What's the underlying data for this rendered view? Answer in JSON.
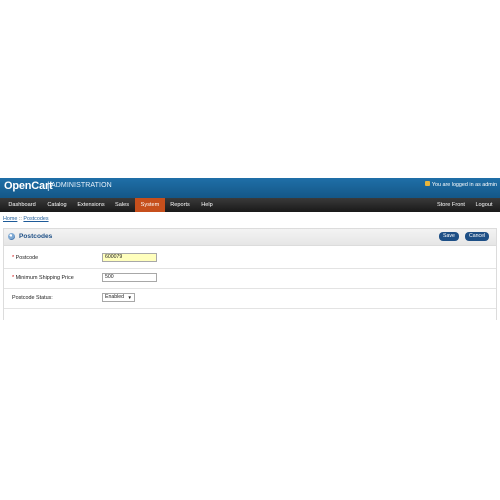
{
  "header": {
    "brand": "OpenCart",
    "separator": "|",
    "subtitle": "ADMINISTRATION",
    "logged_in": "You are logged in as admin"
  },
  "menu": {
    "items": [
      {
        "label": "Dashboard"
      },
      {
        "label": "Catalog"
      },
      {
        "label": "Extensions"
      },
      {
        "label": "Sales"
      },
      {
        "label": "System"
      },
      {
        "label": "Reports"
      },
      {
        "label": "Help"
      }
    ],
    "right_items": [
      {
        "label": "Store Front"
      },
      {
        "label": "Logout"
      }
    ],
    "active": "System"
  },
  "breadcrumb": {
    "home": "Home",
    "sep": "::",
    "current": "Postcodes"
  },
  "box": {
    "title": "Postcodes",
    "save_label": "Save",
    "cancel_label": "Cancel"
  },
  "form": {
    "required_mark": "*",
    "postcode_label": "Postcode",
    "postcode_value": "600079",
    "min_shipping_label": "Minimum Shipping Price",
    "min_shipping_value": "500",
    "status_label": "Postcode Status:",
    "status_value": "Enabled"
  },
  "colors": {
    "header": "#1a63a0",
    "menu": "#262626",
    "active_menu": "#c64f1c",
    "button": "#1d4f86",
    "highlight_input": "#ffffbd"
  }
}
